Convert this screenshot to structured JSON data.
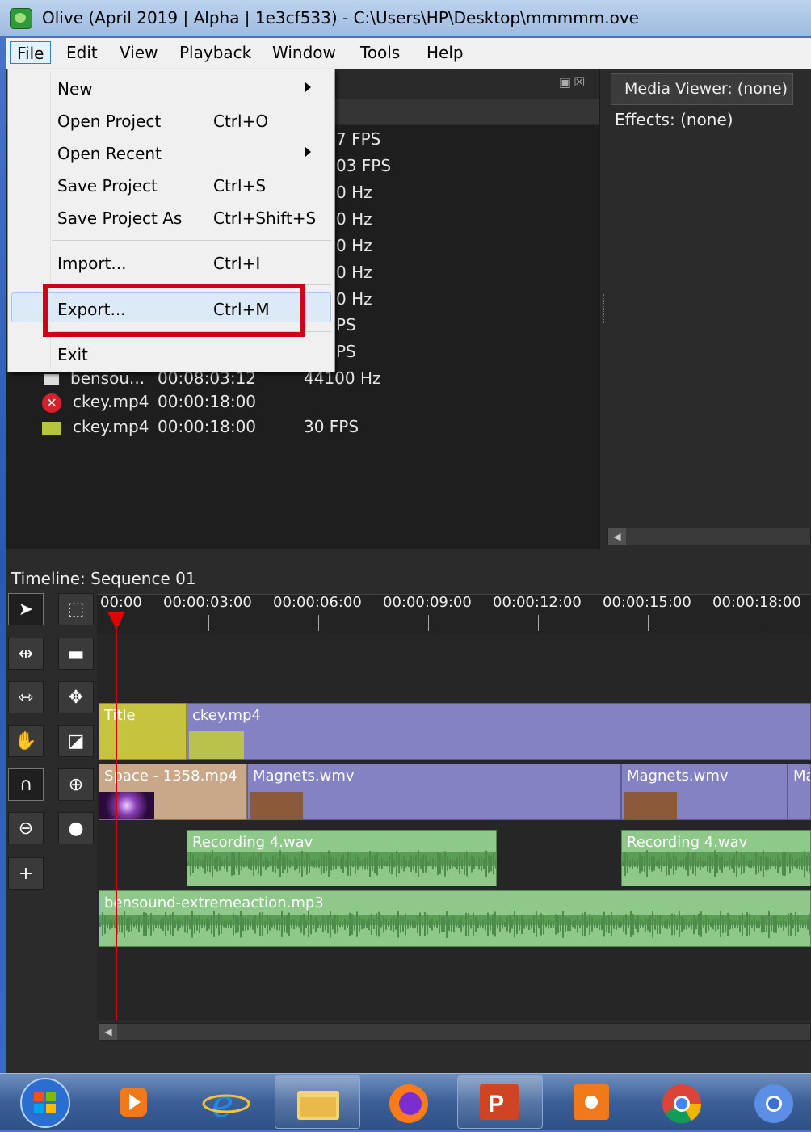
{
  "window": {
    "title": "Olive (April 2019 | Alpha | 1e3cf533) - C:\\Users\\HP\\Desktop\\mmmmm.ove"
  },
  "menubar": {
    "items": [
      "File",
      "Edit",
      "View",
      "Playback",
      "Window",
      "Tools",
      "Help"
    ]
  },
  "file_menu": {
    "new": "New",
    "open_project": "Open Project",
    "open_project_sc": "Ctrl+O",
    "open_recent": "Open Recent",
    "save_project": "Save Project",
    "save_project_sc": "Ctrl+S",
    "save_project_as": "Save Project As",
    "save_project_as_sc": "Ctrl+Shift+S",
    "import": "Import...",
    "import_sc": "Ctrl+I",
    "export": "Export...",
    "export_sc": "Ctrl+M",
    "exit": "Exit"
  },
  "project": {
    "partial_rates": [
      "7 FPS",
      "03 FPS",
      "0 Hz",
      "0 Hz",
      "0 Hz",
      "0 Hz",
      "0 Hz",
      "PS",
      "PS"
    ],
    "rows": [
      {
        "name": "bensou...",
        "duration": "00:08:03:12",
        "rate": "44100 Hz"
      },
      {
        "name": "ckey.mp4",
        "duration": "00:00:18:00",
        "rate": ""
      },
      {
        "name": "ckey.mp4",
        "duration": "00:00:18:00",
        "rate": "30 FPS"
      }
    ]
  },
  "right_panel": {
    "media_viewer_tab": "Media Viewer: (none)",
    "effects_label": "Effects: (none)"
  },
  "timeline": {
    "title": "Timeline: Sequence 01",
    "ticks": [
      "00:00",
      "00:00:03:00",
      "00:00:06:00",
      "00:00:09:00",
      "00:00:12:00",
      "00:00:15:00",
      "00:00:18:00"
    ],
    "clips": {
      "title": "Title",
      "ckey": "ckey.mp4",
      "space": "Space - 1358.mp4",
      "magnets1": "Magnets.wmv",
      "magnets2": "Magnets.wmv",
      "magnets3": "Ma",
      "rec1": "Recording 4.wav",
      "rec2": "Recording 4.wav",
      "music": "bensound-extremeaction.mp3"
    }
  },
  "colors": {
    "highlight": "#d0021b",
    "video_clip": "#8582c4",
    "audio_clip": "#8ec989",
    "playhead": "#d40000"
  }
}
